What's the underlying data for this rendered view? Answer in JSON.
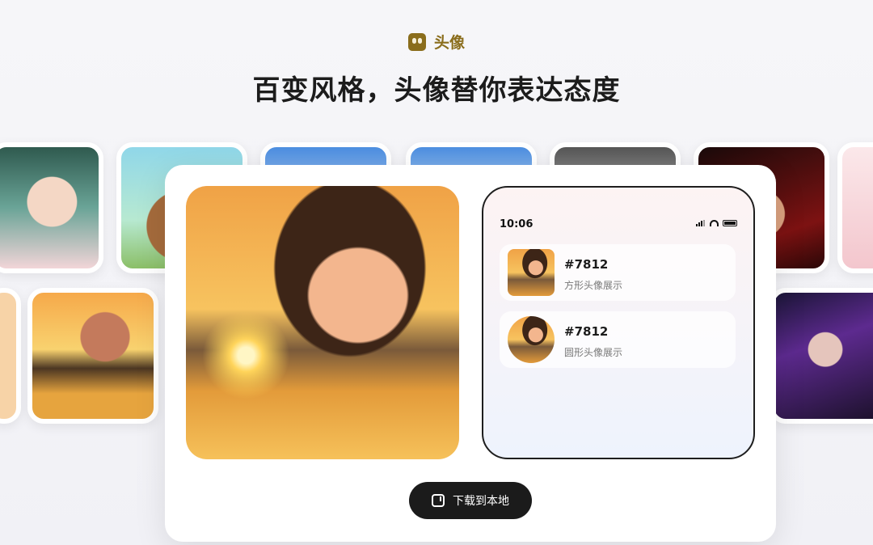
{
  "header": {
    "brand_name": "头像",
    "headline": "百变风格，头像替你表达态度"
  },
  "preview": {
    "phone": {
      "time": "10:06",
      "items": [
        {
          "id": "#7812",
          "label": "方形头像展示"
        },
        {
          "id": "#7812",
          "label": "圆形头像展示"
        }
      ]
    }
  },
  "actions": {
    "download_label": "下载到本地"
  },
  "icons": {
    "brand": "brand-logo-icon",
    "download": "download-icon",
    "signal": "signal-icon",
    "wifi": "wifi-icon",
    "battery": "battery-icon"
  },
  "colors": {
    "brand": "#8a6d1c",
    "button_bg": "#1b1b1b"
  }
}
